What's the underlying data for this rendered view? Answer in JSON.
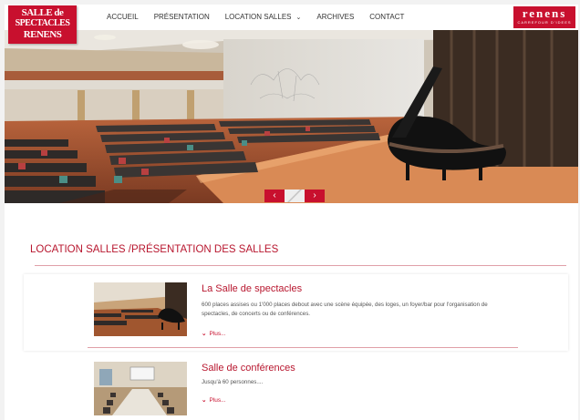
{
  "logo": {
    "line1": "SALLE de",
    "line2": "SPECTACLES",
    "line3": "RENENS"
  },
  "nav": [
    {
      "label": "ACCUEIL"
    },
    {
      "label": "PRÉSENTATION"
    },
    {
      "label": "LOCATION SALLES",
      "has_dropdown": true
    },
    {
      "label": "ARCHIVES"
    },
    {
      "label": "CONTACT"
    }
  ],
  "brand": {
    "name": "renens",
    "tagline": "CARREFOUR D'IDEES"
  },
  "slider": {
    "prev_icon": "chevron-left-icon",
    "next_icon": "chevron-right-icon",
    "prev": "‹",
    "next": "›"
  },
  "section": {
    "title": "LOCATION SALLES /PRÉSENTATION DES SALLES"
  },
  "rooms": [
    {
      "title": "La Salle de spectacles",
      "description": "600 places assises ou 1'000 places debout avec une scène équipée, des loges, un foyer/bar pour l'organisation de spectacles, de concerts ou de conférences.",
      "more": "Plus..."
    },
    {
      "title": "Salle de conférences",
      "description": "Jusqu'à 60 personnes....",
      "more": "Plus..."
    }
  ],
  "colors": {
    "accent": "#c8102e",
    "title": "#b8172f"
  }
}
